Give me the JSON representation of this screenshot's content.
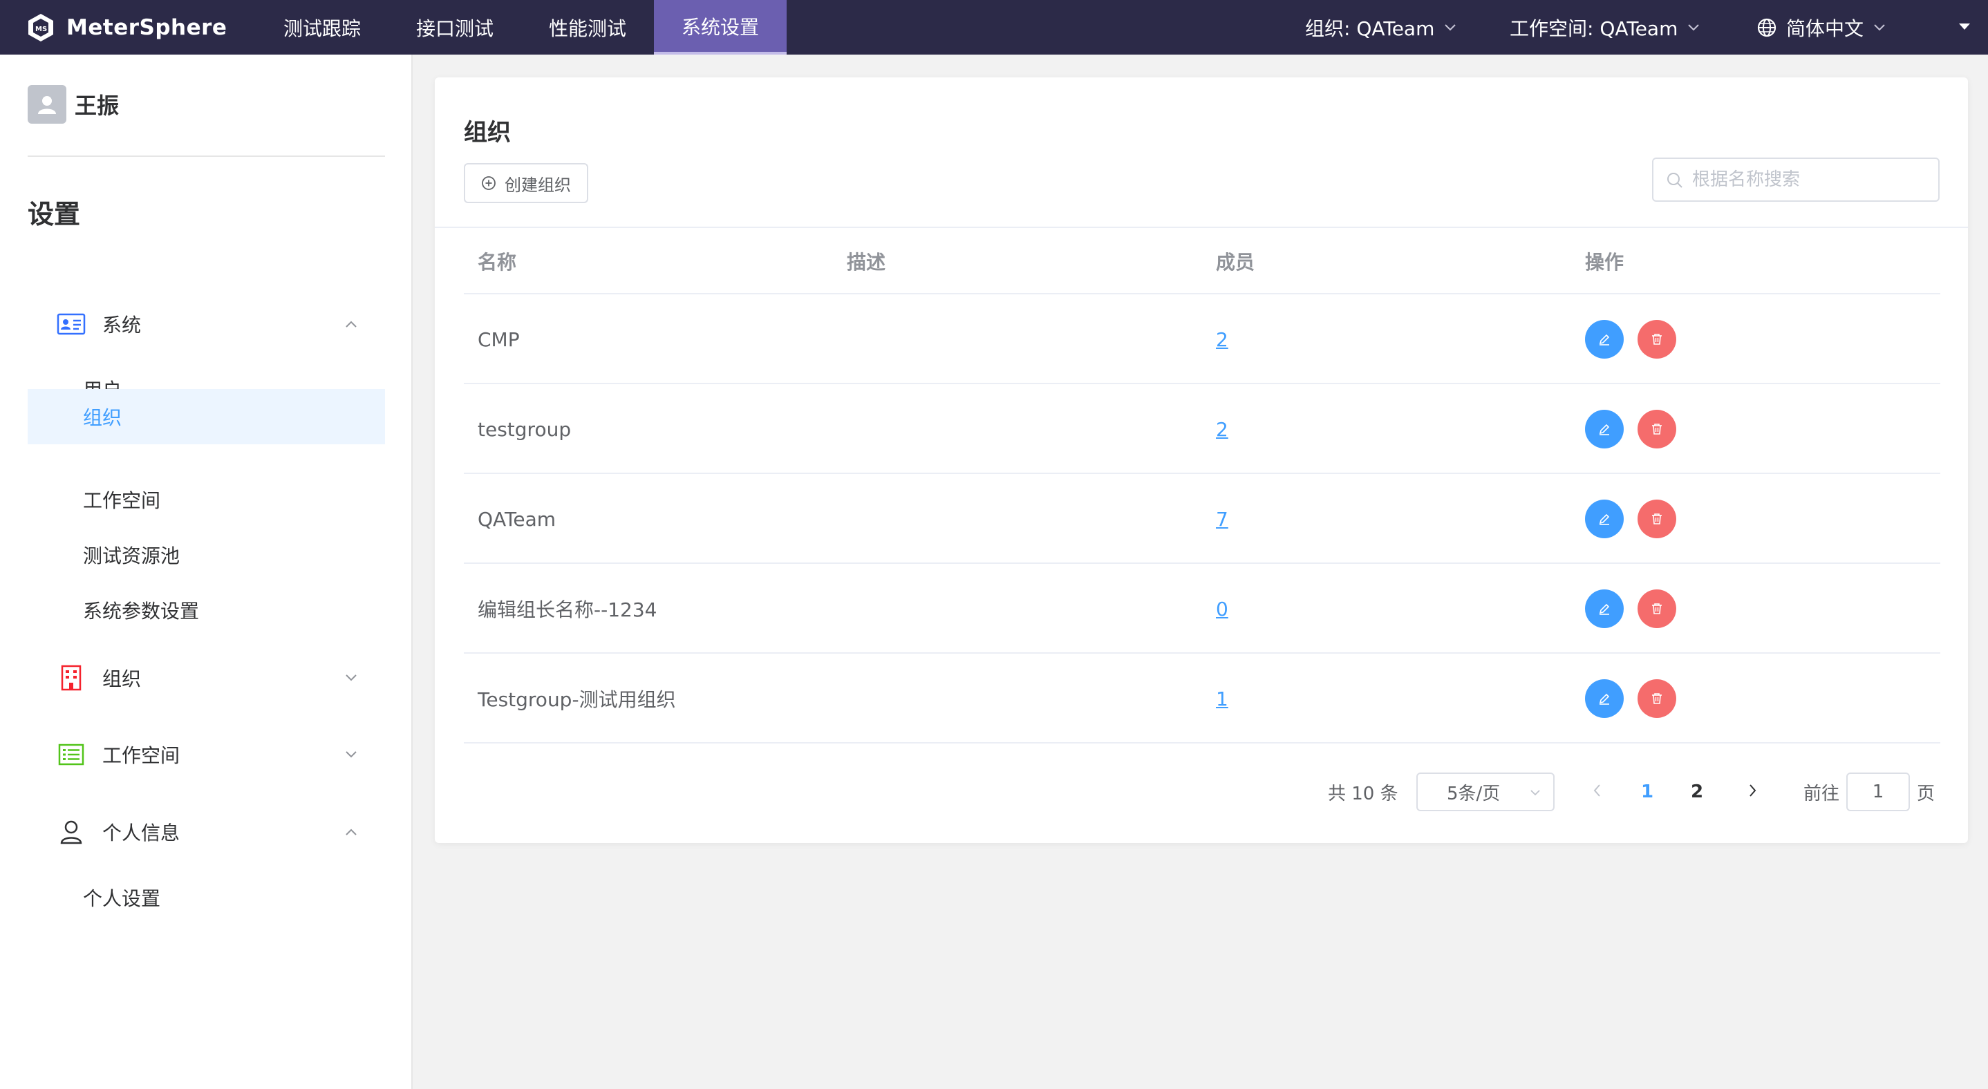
{
  "app": {
    "name": "MeterSphere"
  },
  "nav": {
    "items": [
      {
        "label": "测试跟踪"
      },
      {
        "label": "接口测试"
      },
      {
        "label": "性能测试"
      },
      {
        "label": "系统设置"
      }
    ],
    "active_index": 3
  },
  "header": {
    "organization": "组织: QATeam",
    "workspace": "工作空间: QATeam",
    "language": "简体中文"
  },
  "sidebar": {
    "user_name": "王振",
    "title": "设置",
    "groups": [
      {
        "label": "系统",
        "expanded": true,
        "items": [
          "用户",
          "组织",
          "工作空间",
          "测试资源池",
          "系统参数设置"
        ]
      },
      {
        "label": "组织",
        "expanded": false
      },
      {
        "label": "工作空间",
        "expanded": false
      },
      {
        "label": "个人信息",
        "expanded": true,
        "items": [
          "个人设置"
        ]
      }
    ],
    "active_item": "组织"
  },
  "main": {
    "title": "组织",
    "create_label": "创建组织",
    "search_placeholder": "根据名称搜索",
    "columns": [
      "名称",
      "描述",
      "成员",
      "操作"
    ],
    "rows": [
      {
        "name": "CMP",
        "description": "",
        "members": "2"
      },
      {
        "name": "testgroup",
        "description": "",
        "members": "2"
      },
      {
        "name": "QATeam",
        "description": "",
        "members": "7"
      },
      {
        "name": "编辑组长名称--1234",
        "description": "",
        "members": "0"
      },
      {
        "name": "Testgroup-测试用组织",
        "description": "",
        "members": "1"
      }
    ]
  },
  "pagination": {
    "total_label": "共 10 条",
    "page_size_label": "5条/页",
    "pages": [
      "1",
      "2"
    ],
    "current_page": "1",
    "goto_prefix": "前往",
    "goto_value": "1",
    "goto_suffix": "页"
  },
  "colors": {
    "topbar": "#2c2a48",
    "nav_active": "#6b5fb0",
    "primary": "#409eff",
    "danger": "#f56c6c"
  },
  "icons": {
    "logo": "metersphere-logo-icon",
    "language": "globe-icon",
    "search": "search-icon",
    "create": "plus-circle-icon",
    "edit": "pencil-icon",
    "delete": "trash-icon"
  }
}
